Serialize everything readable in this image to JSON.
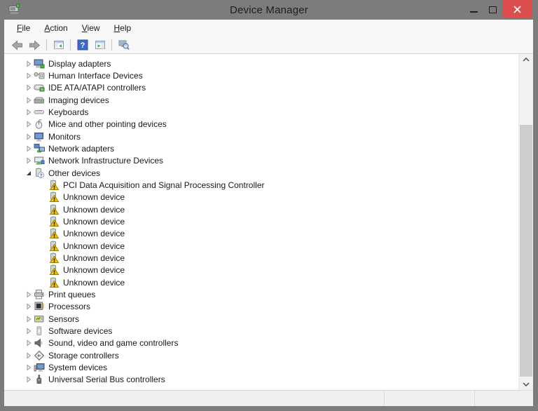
{
  "window": {
    "title": "Device Manager"
  },
  "colors": {
    "titlebar_bg": "#7c7c7c",
    "close_button_red": "#dd4f4f",
    "help_icon_blue": "#3d6ac5",
    "warning_yellow": "#f5c400",
    "green_accent": "#4caf50"
  },
  "titlebar": {
    "app_icon": "device-manager-app-icon",
    "controls": [
      {
        "name": "minimize-button",
        "icon": "minimize-icon"
      },
      {
        "name": "maximize-button",
        "icon": "maximize-icon"
      },
      {
        "name": "close-button",
        "icon": "close-icon"
      }
    ]
  },
  "menubar": {
    "items": [
      {
        "label": "File",
        "underline_index": 0
      },
      {
        "label": "Action",
        "underline_index": 0
      },
      {
        "label": "View",
        "underline_index": 0
      },
      {
        "label": "Help",
        "underline_index": 0
      }
    ]
  },
  "toolbar": {
    "buttons": [
      {
        "name": "back-button",
        "icon": "back-arrow-icon"
      },
      {
        "name": "forward-button",
        "icon": "forward-arrow-icon"
      },
      {
        "type": "separator"
      },
      {
        "name": "console-tree-button",
        "icon": "console-tree-icon"
      },
      {
        "type": "separator"
      },
      {
        "name": "help-button",
        "icon": "help-icon"
      },
      {
        "name": "action-pane-button",
        "icon": "action-pane-icon"
      },
      {
        "type": "separator"
      },
      {
        "name": "scan-hardware-button",
        "icon": "scan-hardware-icon"
      }
    ]
  },
  "tree": {
    "items": [
      {
        "label": "Display adapters",
        "icon": "display-adapter-icon",
        "level": 0,
        "expander": "collapsed"
      },
      {
        "label": "Human Interface Devices",
        "icon": "human-interface-device-icon",
        "level": 0,
        "expander": "collapsed"
      },
      {
        "label": "IDE ATA/ATAPI controllers",
        "icon": "ide-controller-icon",
        "level": 0,
        "expander": "collapsed"
      },
      {
        "label": "Imaging devices",
        "icon": "imaging-device-icon",
        "level": 0,
        "expander": "collapsed"
      },
      {
        "label": "Keyboards",
        "icon": "keyboard-icon",
        "level": 0,
        "expander": "collapsed"
      },
      {
        "label": "Mice and other pointing devices",
        "icon": "mouse-icon",
        "level": 0,
        "expander": "collapsed"
      },
      {
        "label": "Monitors",
        "icon": "monitor-icon",
        "level": 0,
        "expander": "collapsed"
      },
      {
        "label": "Network adapters",
        "icon": "network-adapter-icon",
        "level": 0,
        "expander": "collapsed"
      },
      {
        "label": "Network Infrastructure Devices",
        "icon": "network-infrastructure-icon",
        "level": 0,
        "expander": "collapsed"
      },
      {
        "label": "Other devices",
        "icon": "other-devices-icon",
        "level": 0,
        "expander": "expanded"
      },
      {
        "label": "PCI Data Acquisition and Signal Processing Controller",
        "icon": "unknown-device-warning-icon",
        "level": 1,
        "expander": "none"
      },
      {
        "label": "Unknown device",
        "icon": "unknown-device-warning-icon",
        "level": 1,
        "expander": "none"
      },
      {
        "label": "Unknown device",
        "icon": "unknown-device-warning-icon",
        "level": 1,
        "expander": "none"
      },
      {
        "label": "Unknown device",
        "icon": "unknown-device-warning-icon",
        "level": 1,
        "expander": "none"
      },
      {
        "label": "Unknown device",
        "icon": "unknown-device-warning-icon",
        "level": 1,
        "expander": "none"
      },
      {
        "label": "Unknown device",
        "icon": "unknown-device-warning-icon",
        "level": 1,
        "expander": "none"
      },
      {
        "label": "Unknown device",
        "icon": "unknown-device-warning-icon",
        "level": 1,
        "expander": "none"
      },
      {
        "label": "Unknown device",
        "icon": "unknown-device-warning-icon",
        "level": 1,
        "expander": "none"
      },
      {
        "label": "Unknown device",
        "icon": "unknown-device-warning-icon",
        "level": 1,
        "expander": "none"
      },
      {
        "label": "Print queues",
        "icon": "printer-icon",
        "level": 0,
        "expander": "collapsed"
      },
      {
        "label": "Processors",
        "icon": "processor-icon",
        "level": 0,
        "expander": "collapsed"
      },
      {
        "label": "Sensors",
        "icon": "sensor-icon",
        "level": 0,
        "expander": "collapsed"
      },
      {
        "label": "Software devices",
        "icon": "software-device-icon",
        "level": 0,
        "expander": "collapsed"
      },
      {
        "label": "Sound, video and game controllers",
        "icon": "speaker-icon",
        "level": 0,
        "expander": "collapsed"
      },
      {
        "label": "Storage controllers",
        "icon": "storage-controller-icon",
        "level": 0,
        "expander": "collapsed"
      },
      {
        "label": "System devices",
        "icon": "system-device-icon",
        "level": 0,
        "expander": "collapsed"
      },
      {
        "label": "Universal Serial Bus controllers",
        "icon": "usb-controller-icon",
        "level": 0,
        "expander": "collapsed"
      }
    ]
  },
  "scrollbar": {
    "orientation": "vertical"
  },
  "statusbar": {
    "sections": [
      "",
      "",
      ""
    ]
  }
}
